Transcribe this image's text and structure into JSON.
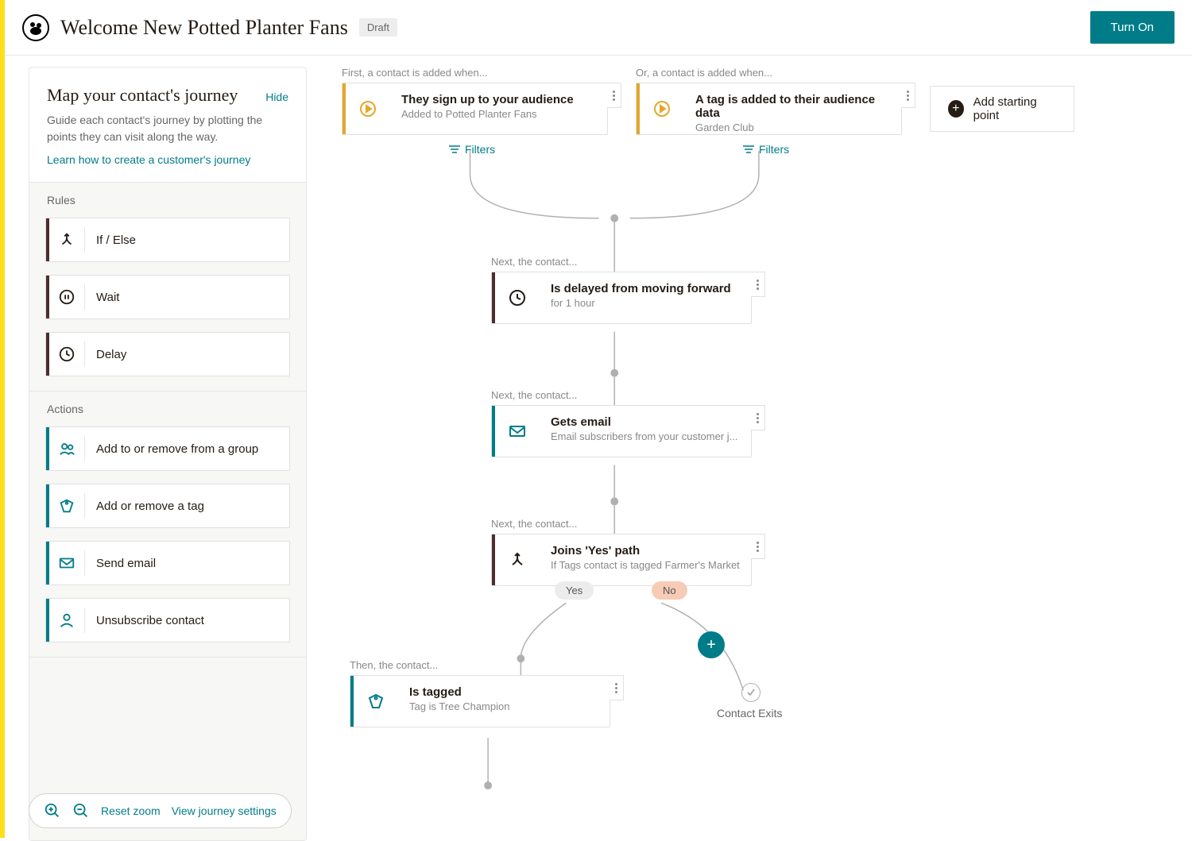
{
  "header": {
    "title": "Welcome New Potted Planter Fans",
    "status": "Draft",
    "turn_on": "Turn On"
  },
  "sidebar": {
    "title": "Map your contact's journey",
    "hide": "Hide",
    "description": "Guide each contact's journey by plotting the points they can visit along the way.",
    "learn": "Learn how to create a customer's journey",
    "rules_label": "Rules",
    "actions_label": "Actions",
    "rules": [
      {
        "label": "If / Else"
      },
      {
        "label": "Wait"
      },
      {
        "label": "Delay"
      }
    ],
    "actions": [
      {
        "label": "Add to or remove from a group"
      },
      {
        "label": "Add or remove a tag"
      },
      {
        "label": "Send email"
      },
      {
        "label": "Unsubscribe contact"
      }
    ]
  },
  "footer": {
    "reset": "Reset zoom",
    "settings": "View journey settings"
  },
  "canvas": {
    "start_first": "First, a contact is added when...",
    "start_or": "Or, a contact is added when...",
    "trigger1": {
      "title": "They sign up to your audience",
      "sub": "Added to Potted Planter Fans"
    },
    "trigger2": {
      "title": "A tag is added to their audience data",
      "sub": "Garden Club"
    },
    "filters": "Filters",
    "add_start": "Add starting point",
    "next_label": "Next, the contact...",
    "then_label": "Then, the contact...",
    "delay": {
      "title": "Is delayed from moving forward",
      "sub": "for 1 hour"
    },
    "email": {
      "title": "Gets email",
      "sub": "Email subscribers from your customer j..."
    },
    "ifelse": {
      "title": "Joins 'Yes' path",
      "sub": "If Tags contact is tagged Farmer's Market",
      "yes": "Yes",
      "no": "No"
    },
    "tag": {
      "title": "Is tagged",
      "sub": "Tag is Tree Champion"
    },
    "exit": "Contact Exits"
  }
}
